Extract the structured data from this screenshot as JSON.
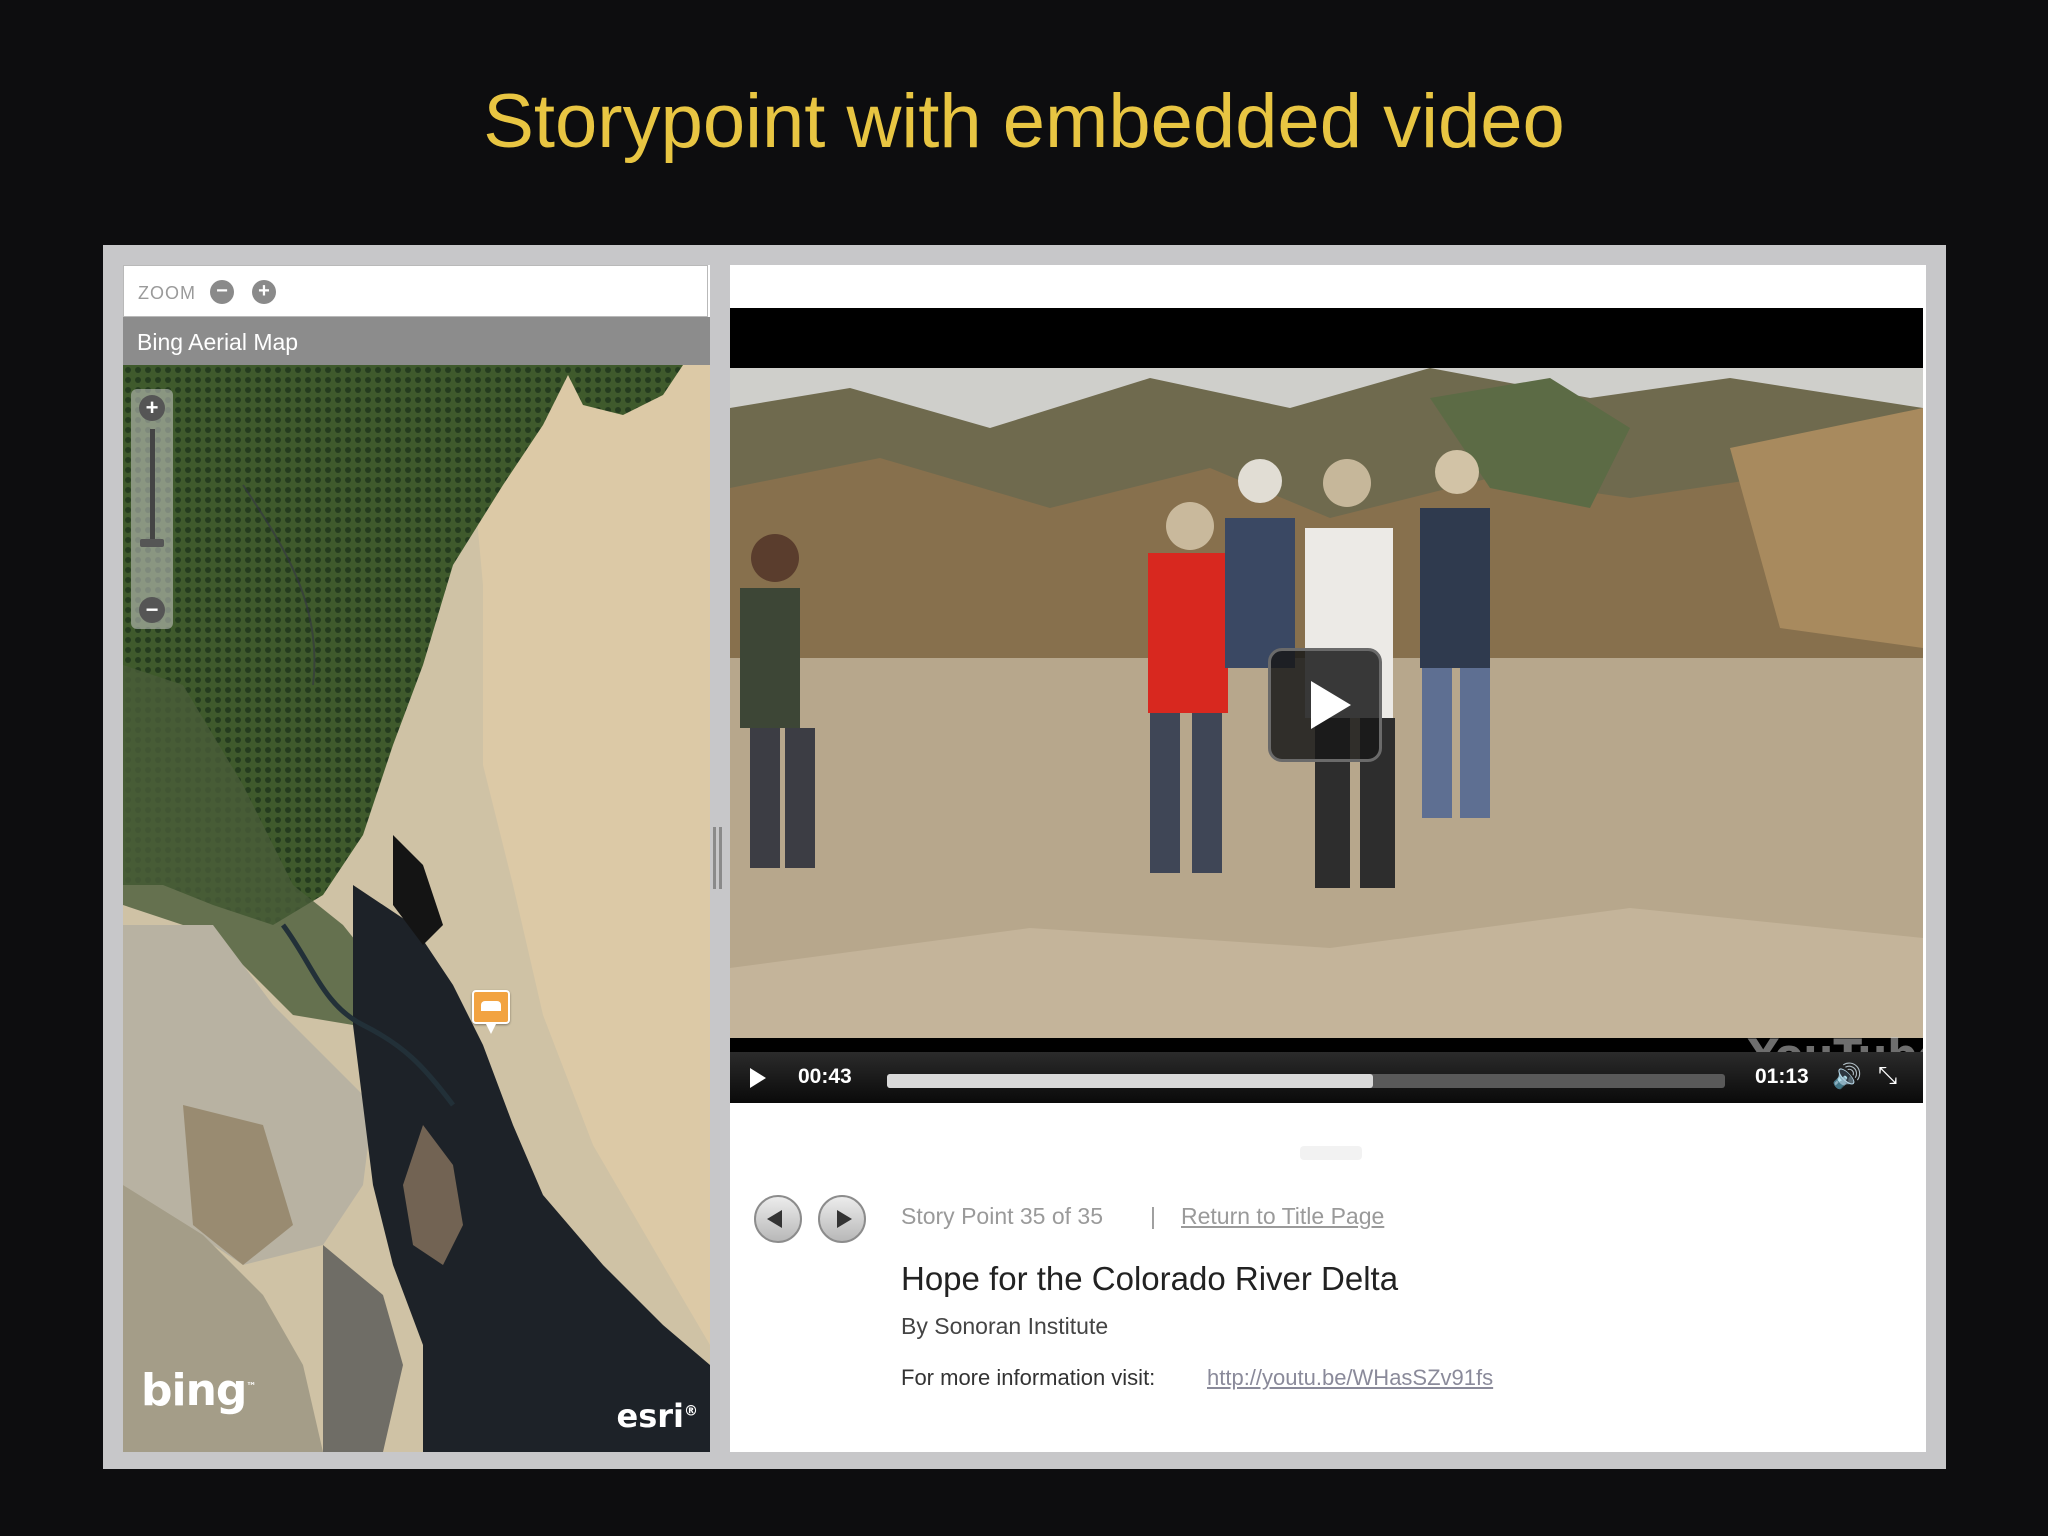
{
  "slide": {
    "title": "Storypoint with embedded video"
  },
  "map": {
    "zoom_label": "ZOOM",
    "zoom_out_glyph": "−",
    "zoom_in_glyph": "+",
    "header": "Bing Aerial Map",
    "slider_plus_glyph": "+",
    "slider_minus_glyph": "−",
    "bing_logo": "bing",
    "esri_logo": "esri",
    "marker_icon": "pin-marker-icon"
  },
  "video": {
    "current_time": "00:43",
    "duration": "01:13",
    "progress": 0.58,
    "watermark": "YouTube",
    "volume_glyph": "🔊",
    "fullscreen_glyph": "⤡"
  },
  "story": {
    "count_text": "Story Point 35 of 35",
    "separator": "|",
    "return_link": "Return to Title Page",
    "title": "Hope for the Colorado River Delta",
    "author": "By Sonoran Institute",
    "info_label": "For more information visit:",
    "info_link": "http://youtu.be/WHasSZv91fs"
  },
  "colors": {
    "title_yellow": "#e8c542",
    "background": "#0d0d0f",
    "frame_gray": "#c7c7c9"
  }
}
